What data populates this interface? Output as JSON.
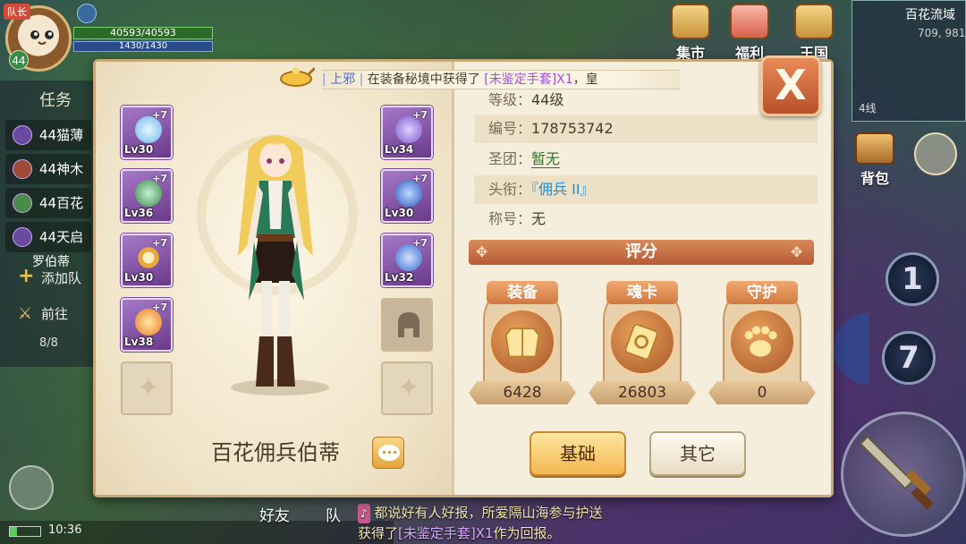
{
  "hud": {
    "leader_badge": "队长",
    "player_level": "44",
    "hp_text": "40593/40593",
    "mp_text": "1430/1430",
    "quest_tab_label": "任务",
    "quests": [
      {
        "label": "44猫薄"
      },
      {
        "label": "44神木"
      },
      {
        "label": "44百花"
      },
      {
        "label": "44天启"
      }
    ],
    "quest_sub": "罗伯蒂",
    "add_team_label": "添加队",
    "goto_label": "前往",
    "page_count": "8/8",
    "top_buttons": [
      "集市",
      "福利",
      "王国"
    ],
    "map_name": "百花流域",
    "map_coords": "709, 981",
    "line_label": "4线",
    "bag_label": "背包",
    "skill_1": "1",
    "skill_7": "7",
    "time": "10:36",
    "bottom_friend": "好友",
    "bottom_team": "队",
    "broadcast_line1": "都说好有人好报，所爱隔山海参与护送",
    "broadcast_line2_pre": "获得了",
    "broadcast_line2_item": "[未鉴定手套]X1",
    "broadcast_line2_post": "作为回报。"
  },
  "notice": {
    "sep": "|",
    "who": "上邪",
    "text": "在装备秘境中获得了",
    "item": "[未鉴定手套]X1",
    "tail": "，皇"
  },
  "equipment": {
    "left": [
      {
        "level": "Lv30",
        "plus": "+7",
        "color": "#8ac8f0"
      },
      {
        "level": "Lv36",
        "plus": "+7",
        "color": "#5aa86a"
      },
      {
        "level": "Lv30",
        "plus": "+7",
        "color": "#e8b03a"
      },
      {
        "level": "Lv38",
        "plus": "+7",
        "color": "#f4a83a"
      }
    ],
    "right": [
      {
        "level": "Lv34",
        "plus": "+7",
        "color": "#9a7ad8"
      },
      {
        "level": "Lv30",
        "plus": "+7",
        "color": "#3a6ad0"
      },
      {
        "level": "Lv32",
        "plus": "+7",
        "color": "#4a7ad8"
      }
    ]
  },
  "character": {
    "name": "百花佣兵伯蒂"
  },
  "info": {
    "level_key": "等级：",
    "level_val": "44级",
    "id_key": "编号：",
    "id_val": "178753742",
    "guild_key": "圣团：",
    "guild_val": "暂无",
    "title_key": "头衔：",
    "title_val": "『佣兵 II』",
    "nickname_key": "称号：",
    "nickname_val": "无"
  },
  "score": {
    "header": "评分",
    "cards": [
      {
        "label": "装备",
        "value": "6428",
        "icon": "armor-icon"
      },
      {
        "label": "魂卡",
        "value": "26803",
        "icon": "soul-card-icon"
      },
      {
        "label": "守护",
        "value": "0",
        "icon": "paw-icon"
      }
    ]
  },
  "buttons": {
    "basic": "基础",
    "other": "其它",
    "close": "X"
  },
  "colors": {
    "panel_bg": "#f4ead6",
    "accent_orange": "#b85a36",
    "purple_slot": "#6a3a8a"
  }
}
